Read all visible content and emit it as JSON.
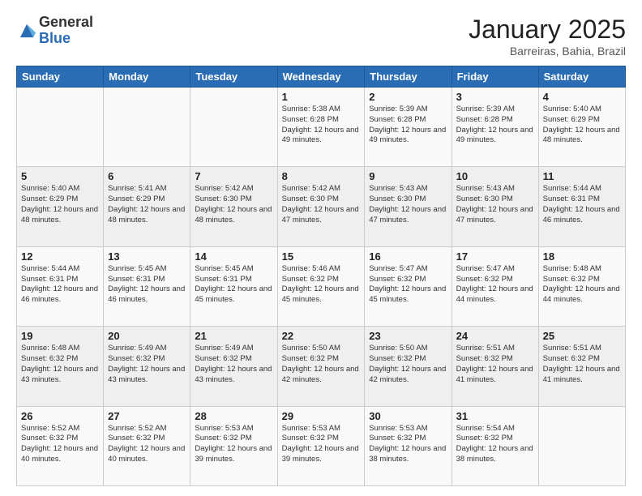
{
  "header": {
    "logo_general": "General",
    "logo_blue": "Blue",
    "month": "January 2025",
    "location": "Barreiras, Bahia, Brazil"
  },
  "days_of_week": [
    "Sunday",
    "Monday",
    "Tuesday",
    "Wednesday",
    "Thursday",
    "Friday",
    "Saturday"
  ],
  "weeks": [
    [
      {
        "day": "",
        "info": ""
      },
      {
        "day": "",
        "info": ""
      },
      {
        "day": "",
        "info": ""
      },
      {
        "day": "1",
        "info": "Sunrise: 5:38 AM\nSunset: 6:28 PM\nDaylight: 12 hours and 49 minutes."
      },
      {
        "day": "2",
        "info": "Sunrise: 5:39 AM\nSunset: 6:28 PM\nDaylight: 12 hours and 49 minutes."
      },
      {
        "day": "3",
        "info": "Sunrise: 5:39 AM\nSunset: 6:28 PM\nDaylight: 12 hours and 49 minutes."
      },
      {
        "day": "4",
        "info": "Sunrise: 5:40 AM\nSunset: 6:29 PM\nDaylight: 12 hours and 48 minutes."
      }
    ],
    [
      {
        "day": "5",
        "info": "Sunrise: 5:40 AM\nSunset: 6:29 PM\nDaylight: 12 hours and 48 minutes."
      },
      {
        "day": "6",
        "info": "Sunrise: 5:41 AM\nSunset: 6:29 PM\nDaylight: 12 hours and 48 minutes."
      },
      {
        "day": "7",
        "info": "Sunrise: 5:42 AM\nSunset: 6:30 PM\nDaylight: 12 hours and 48 minutes."
      },
      {
        "day": "8",
        "info": "Sunrise: 5:42 AM\nSunset: 6:30 PM\nDaylight: 12 hours and 47 minutes."
      },
      {
        "day": "9",
        "info": "Sunrise: 5:43 AM\nSunset: 6:30 PM\nDaylight: 12 hours and 47 minutes."
      },
      {
        "day": "10",
        "info": "Sunrise: 5:43 AM\nSunset: 6:30 PM\nDaylight: 12 hours and 47 minutes."
      },
      {
        "day": "11",
        "info": "Sunrise: 5:44 AM\nSunset: 6:31 PM\nDaylight: 12 hours and 46 minutes."
      }
    ],
    [
      {
        "day": "12",
        "info": "Sunrise: 5:44 AM\nSunset: 6:31 PM\nDaylight: 12 hours and 46 minutes."
      },
      {
        "day": "13",
        "info": "Sunrise: 5:45 AM\nSunset: 6:31 PM\nDaylight: 12 hours and 46 minutes."
      },
      {
        "day": "14",
        "info": "Sunrise: 5:45 AM\nSunset: 6:31 PM\nDaylight: 12 hours and 45 minutes."
      },
      {
        "day": "15",
        "info": "Sunrise: 5:46 AM\nSunset: 6:32 PM\nDaylight: 12 hours and 45 minutes."
      },
      {
        "day": "16",
        "info": "Sunrise: 5:47 AM\nSunset: 6:32 PM\nDaylight: 12 hours and 45 minutes."
      },
      {
        "day": "17",
        "info": "Sunrise: 5:47 AM\nSunset: 6:32 PM\nDaylight: 12 hours and 44 minutes."
      },
      {
        "day": "18",
        "info": "Sunrise: 5:48 AM\nSunset: 6:32 PM\nDaylight: 12 hours and 44 minutes."
      }
    ],
    [
      {
        "day": "19",
        "info": "Sunrise: 5:48 AM\nSunset: 6:32 PM\nDaylight: 12 hours and 43 minutes."
      },
      {
        "day": "20",
        "info": "Sunrise: 5:49 AM\nSunset: 6:32 PM\nDaylight: 12 hours and 43 minutes."
      },
      {
        "day": "21",
        "info": "Sunrise: 5:49 AM\nSunset: 6:32 PM\nDaylight: 12 hours and 43 minutes."
      },
      {
        "day": "22",
        "info": "Sunrise: 5:50 AM\nSunset: 6:32 PM\nDaylight: 12 hours and 42 minutes."
      },
      {
        "day": "23",
        "info": "Sunrise: 5:50 AM\nSunset: 6:32 PM\nDaylight: 12 hours and 42 minutes."
      },
      {
        "day": "24",
        "info": "Sunrise: 5:51 AM\nSunset: 6:32 PM\nDaylight: 12 hours and 41 minutes."
      },
      {
        "day": "25",
        "info": "Sunrise: 5:51 AM\nSunset: 6:32 PM\nDaylight: 12 hours and 41 minutes."
      }
    ],
    [
      {
        "day": "26",
        "info": "Sunrise: 5:52 AM\nSunset: 6:32 PM\nDaylight: 12 hours and 40 minutes."
      },
      {
        "day": "27",
        "info": "Sunrise: 5:52 AM\nSunset: 6:32 PM\nDaylight: 12 hours and 40 minutes."
      },
      {
        "day": "28",
        "info": "Sunrise: 5:53 AM\nSunset: 6:32 PM\nDaylight: 12 hours and 39 minutes."
      },
      {
        "day": "29",
        "info": "Sunrise: 5:53 AM\nSunset: 6:32 PM\nDaylight: 12 hours and 39 minutes."
      },
      {
        "day": "30",
        "info": "Sunrise: 5:53 AM\nSunset: 6:32 PM\nDaylight: 12 hours and 38 minutes."
      },
      {
        "day": "31",
        "info": "Sunrise: 5:54 AM\nSunset: 6:32 PM\nDaylight: 12 hours and 38 minutes."
      },
      {
        "day": "",
        "info": ""
      }
    ]
  ]
}
